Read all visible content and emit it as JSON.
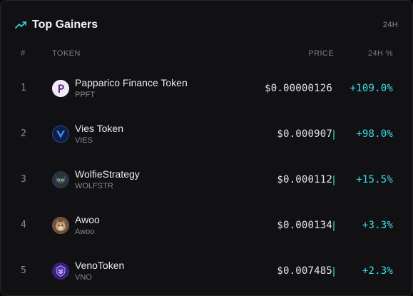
{
  "header": {
    "title": "Top Gainers",
    "period": "24H",
    "icon": "trending-up-icon",
    "accent": "#3fd5e8"
  },
  "columns": {
    "rank": "#",
    "token": "TOKEN",
    "price": "PRICE",
    "change": "24H %"
  },
  "colors": {
    "positive": "#35e0e8",
    "tick": "#2a9d8f"
  },
  "tokens": [
    {
      "rank": "1",
      "name": "Papparico Finance Token",
      "symbol": "PPFT",
      "price": "$0.00000126",
      "change": "+109.0%",
      "icon": "papparico-logo",
      "icon_bg": "#f3eaf7",
      "icon_fg": "#5b2a86",
      "icon_char": "P"
    },
    {
      "rank": "2",
      "name": "Vies Token",
      "symbol": "VIES",
      "price": "$0.000907",
      "change": "+98.0%",
      "icon": "vies-logo",
      "icon_bg": "#0f1c3f",
      "icon_fg": "#3b8cff",
      "icon_char": "V"
    },
    {
      "rank": "3",
      "name": "WolfieStrategy",
      "symbol": "WOLFSTR",
      "price": "$0.000112",
      "change": "+15.5%",
      "icon": "wolfie-logo",
      "icon_bg": "#2c3340",
      "icon_fg": "#7cd67a",
      "icon_char": ""
    },
    {
      "rank": "4",
      "name": "Awoo",
      "symbol": "Awoo",
      "price": "$0.000134",
      "change": "+3.3%",
      "icon": "awoo-logo",
      "icon_bg": "#8a6a52",
      "icon_fg": "#e9d4bf",
      "icon_char": ""
    },
    {
      "rank": "5",
      "name": "VenoToken",
      "symbol": "VNO",
      "price": "$0.007485",
      "change": "+2.3%",
      "icon": "veno-logo",
      "icon_bg": "#3a1f7a",
      "icon_fg": "#c9b6ff",
      "icon_char": ""
    }
  ]
}
